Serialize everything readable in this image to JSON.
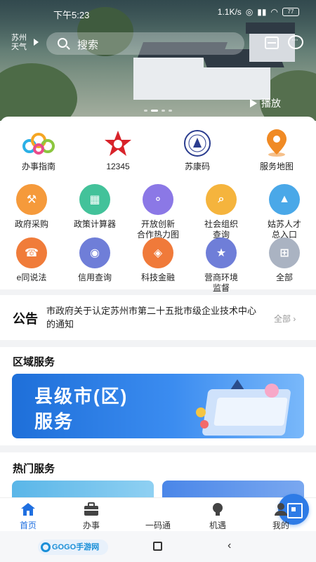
{
  "status_bar": {
    "time": "下午5:23",
    "network_speed": "1.1K/s",
    "battery": "77"
  },
  "header": {
    "weather_label": "苏州\n天气",
    "search_placeholder": "搜索",
    "play_label": "播放"
  },
  "services": [
    {
      "label": "办事指南",
      "icon": "colorful-s-logo-icon",
      "color": "#2bb0e6"
    },
    {
      "label": "12345",
      "icon": "red-hotline-logo-icon",
      "color": "#d8232a"
    },
    {
      "label": "苏康码",
      "icon": "seal-badge-icon",
      "color": "#2b3d8f"
    },
    {
      "label": "服务地图",
      "icon": "map-pin-icon",
      "color": "#f08a24"
    },
    {
      "label": "政府采购",
      "icon": "gavel-icon",
      "color": "#f59a3b"
    },
    {
      "label": "政策计算器",
      "icon": "calculator-icon",
      "color": "#43c29a"
    },
    {
      "label": "开放创新\n合作热力图",
      "icon": "bubbles-icon",
      "color": "#8b78e6"
    },
    {
      "label": "社会组织\n查询",
      "icon": "org-search-icon",
      "color": "#f5b43d"
    },
    {
      "label": "姑苏人才\n总入口",
      "icon": "graduation-cap-icon",
      "color": "#4aa8e8"
    },
    {
      "label": "e同说法",
      "icon": "phone-icon",
      "color": "#f07c3a"
    },
    {
      "label": "信用查询",
      "icon": "credit-icon",
      "color": "#6f7ed8"
    },
    {
      "label": "科技金融",
      "icon": "tech-finance-icon",
      "color": "#f07a3a"
    },
    {
      "label": "营商环境\n监督",
      "icon": "police-cap-icon",
      "color": "#6f7ed8"
    },
    {
      "label": "全部",
      "icon": "grid-all-icon",
      "color": "#aab3c2"
    }
  ],
  "notice": {
    "tag": "公告",
    "text": "市政府关于认定苏州市第二十五批市级企业技术中心的通知",
    "more": "全部"
  },
  "region": {
    "title": "区域服务",
    "banner_line1": "县级市(区)",
    "banner_line2": "服务"
  },
  "hot": {
    "title": "热门服务"
  },
  "tabs": [
    {
      "label": "首页",
      "active": true
    },
    {
      "label": "办事",
      "active": false
    },
    {
      "label": "一码通",
      "active": false
    },
    {
      "label": "机遇",
      "active": false
    },
    {
      "label": "我的",
      "active": false
    }
  ],
  "watermark": "GOGO手游网"
}
